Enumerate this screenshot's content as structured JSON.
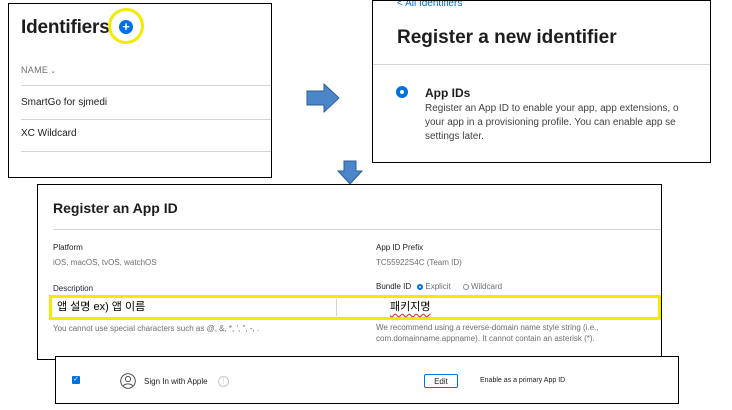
{
  "identifiers_panel": {
    "title": "Identifiers",
    "add_icon": "+",
    "column_header": "NAME",
    "column_chevron": "⌄",
    "rows": [
      "SmartGo for sjmedi",
      "XC Wildcard"
    ]
  },
  "new_identifier_panel": {
    "back_link": "< All Identifiers",
    "title": "Register a new identifier",
    "option_title": "App IDs",
    "option_desc_lines": [
      "Register an App ID to enable your app, app extensions, o",
      "your app in a provisioning profile. You can enable app se",
      "settings later."
    ]
  },
  "app_id_panel": {
    "title": "Register an App ID",
    "platform_label": "Platform",
    "platform_value": "iOS, macOS, tvOS, watchOS",
    "prefix_label": "App ID Prefix",
    "prefix_value": "TC55922S4C (Team ID)",
    "description_label": "Description",
    "bundle_label": "Bundle ID",
    "bundle_explicit": "Explicit",
    "bundle_wildcard": "Wildcard",
    "description_value": "앱 설명 ex) 앱 이름",
    "bundle_value": "패키지명",
    "description_help": "You cannot use special characters such as @, &, *, ', \", -, .",
    "bundle_help_lines": [
      "We recommend using a reverse-domain name style string (i.e.,",
      "com.domainname.appname). It cannot contain an asterisk (*)."
    ]
  },
  "capability_panel": {
    "checkbox_mark": "✓",
    "label": "Sign In with Apple",
    "info_icon": "i",
    "edit_label": "Edit",
    "primary_label": "Enable as a primary App ID"
  },
  "colors": {
    "accent": "#0071e3",
    "highlight": "#f2eb00",
    "arrow": "#4a86c8"
  }
}
